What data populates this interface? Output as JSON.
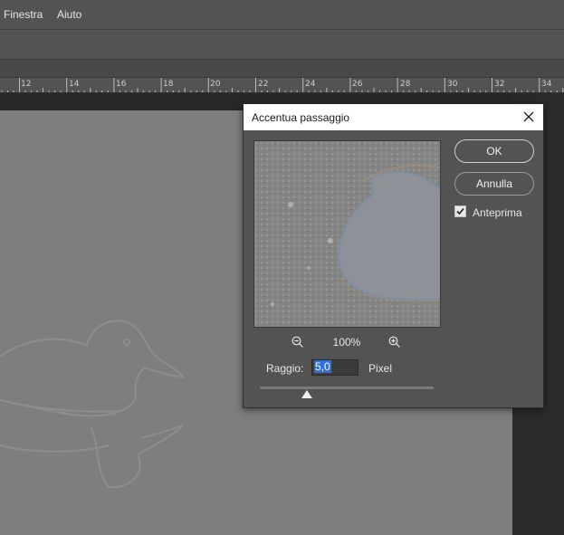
{
  "menubar": {
    "items": [
      "Finestra",
      "Aiuto"
    ]
  },
  "ruler": {
    "labels": [
      "12",
      "14",
      "16",
      "18",
      "20",
      "22",
      "24",
      "26",
      "28",
      "30",
      "32",
      "34"
    ]
  },
  "dialog": {
    "title": "Accentua passaggio",
    "zoom_value": "100%",
    "radius_label": "Raggio:",
    "radius_value": "5,0",
    "radius_unit": "Pixel",
    "slider_level_fraction": 0.27,
    "ok_label": "OK",
    "cancel_label": "Annulla",
    "preview_label": "Anteprima",
    "preview_checked": true
  },
  "icons": {
    "close": "close-icon",
    "zoom_out": "zoom-out-icon",
    "zoom_in": "zoom-in-icon",
    "check": "checkmark-icon"
  }
}
